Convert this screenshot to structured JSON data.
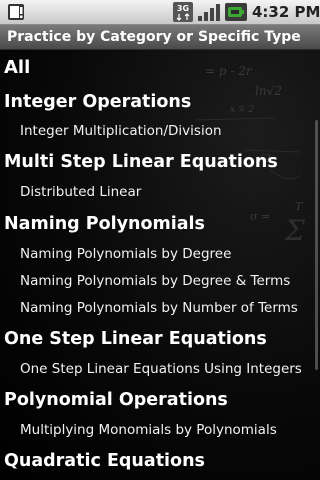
{
  "status_bar": {
    "time": "4:32 PM",
    "network": "3G",
    "icons": [
      "notification-icon",
      "3g-data-icon",
      "signal-strength-icon",
      "battery-charging-icon"
    ]
  },
  "header": {
    "title": "Practice by Category or Specific Type"
  },
  "list": {
    "items": [
      {
        "kind": "category",
        "label": "All"
      },
      {
        "kind": "category",
        "label": "Integer Operations"
      },
      {
        "kind": "type",
        "label": "Integer Multiplication/Division"
      },
      {
        "kind": "category",
        "label": "Multi Step Linear Equations"
      },
      {
        "kind": "type",
        "label": "Distributed Linear"
      },
      {
        "kind": "category",
        "label": "Naming Polynomials"
      },
      {
        "kind": "type",
        "label": "Naming Polynomials by Degree"
      },
      {
        "kind": "type",
        "label": "Naming Polynomials by Degree & Terms"
      },
      {
        "kind": "type",
        "label": "Naming Polynomials by Number of Terms"
      },
      {
        "kind": "category",
        "label": "One Step Linear Equations"
      },
      {
        "kind": "type",
        "label": "One Step Linear Equations Using Integers"
      },
      {
        "kind": "category",
        "label": "Polynomial Operations"
      },
      {
        "kind": "type",
        "label": "Multiplying Monomials by Polynomials"
      },
      {
        "kind": "category",
        "label": "Quadratic Equations"
      }
    ]
  },
  "colors": {
    "background": "#000000",
    "text": "#ffffff",
    "title_bar": "#5e5e5e",
    "status_bar": "#e0e0e0",
    "battery_accent": "#3aa832"
  }
}
